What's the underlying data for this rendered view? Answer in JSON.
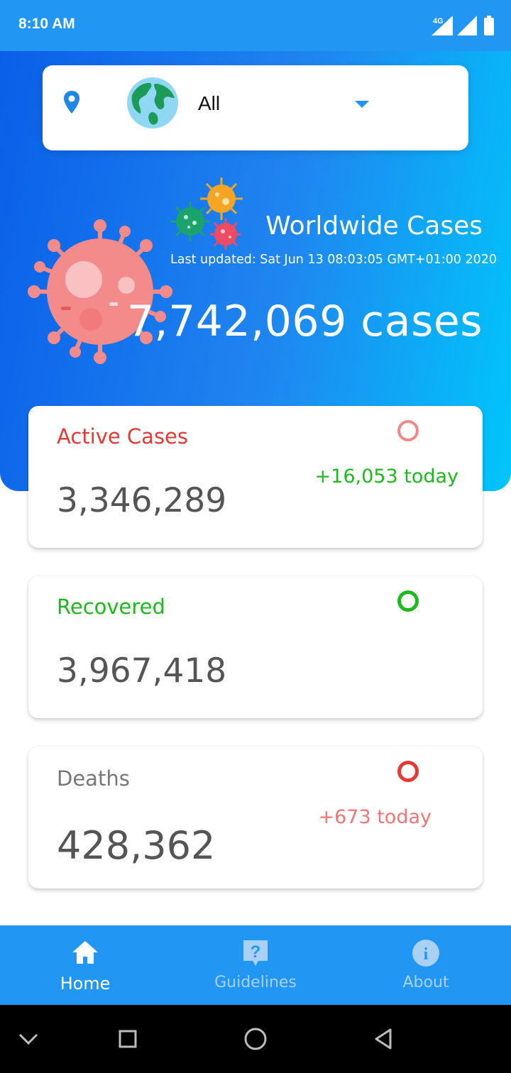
{
  "status_bar": {
    "time": "8:10 AM",
    "network": "4G"
  },
  "selector": {
    "value": "All"
  },
  "worldwide": {
    "title": "Worldwide Cases",
    "last_updated": "Last updated: Sat Jun 13 08:03:05 GMT+01:00 2020",
    "total": "7,742,069 cases"
  },
  "cards": {
    "active": {
      "title": "Active Cases",
      "value": "3,346,289",
      "today": "+16,053 today",
      "color": "#e53935"
    },
    "recovered": {
      "title": "Recovered",
      "value": "3,967,418",
      "today": "",
      "color": "#1db91d"
    },
    "deaths": {
      "title": "Deaths",
      "value": "428,362",
      "today": "+673 today",
      "color": "#ef7676"
    }
  },
  "bottom_nav": {
    "items": [
      {
        "label": "Home",
        "icon": "home-icon",
        "active": true
      },
      {
        "label": "Guidelines",
        "icon": "help-icon",
        "active": false
      },
      {
        "label": "About",
        "icon": "info-icon",
        "active": false
      }
    ]
  },
  "colors": {
    "primary": "#2196f3",
    "hero_start": "#0a5fe8",
    "hero_end": "#00c6fb"
  }
}
